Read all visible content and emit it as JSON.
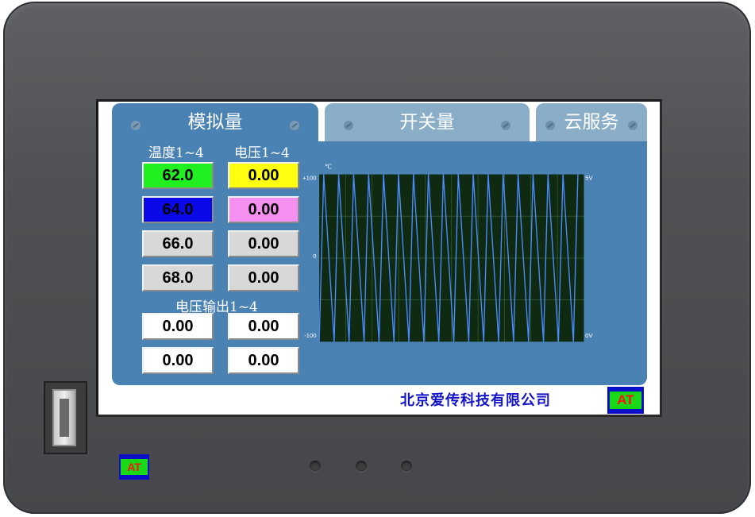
{
  "tabs": [
    {
      "label": "模拟量",
      "active": true
    },
    {
      "label": "开关量",
      "active": false
    },
    {
      "label": "云服务",
      "active": false
    }
  ],
  "analog": {
    "temp_label": "温度1~4",
    "volt_label": "电压1~4",
    "out_label": "电压输出1~4",
    "temps": [
      {
        "value": "62.0",
        "bg": "#20f020",
        "fg": "#000000"
      },
      {
        "value": "64.0",
        "bg": "#0a0ae8",
        "fg": "#000000"
      },
      {
        "value": "66.0",
        "bg": "#d8d8d8",
        "fg": "#000000"
      },
      {
        "value": "68.0",
        "bg": "#d8d8d8",
        "fg": "#000000"
      }
    ],
    "volts": [
      {
        "value": "0.00",
        "bg": "#ffff10",
        "fg": "#000000"
      },
      {
        "value": "0.00",
        "bg": "#f590f0",
        "fg": "#000000"
      },
      {
        "value": "0.00",
        "bg": "#d8d8d8",
        "fg": "#000000"
      },
      {
        "value": "0.00",
        "bg": "#d8d8d8",
        "fg": "#000000"
      }
    ],
    "outputs": [
      "0.00",
      "0.00",
      "0.00",
      "0.00"
    ]
  },
  "chart": {
    "unit_left": "℃",
    "y_left_top": "+100",
    "y_left_mid": "0",
    "y_left_bottom": "-100",
    "y_right_top": "5V",
    "y_right_bottom": "0V",
    "background": "#0f2a10",
    "grid_color": "#3c6a3c",
    "line_color": "#4a8aff"
  },
  "chart_data": {
    "type": "line",
    "title": "",
    "ylabel": "℃",
    "ylim": [
      -100,
      100
    ],
    "y2lim": [
      0,
      5
    ],
    "series": [
      {
        "values": [
          -100,
          100,
          -100,
          100,
          -100,
          100,
          -100,
          100,
          -100,
          100,
          -100,
          100,
          -100,
          100,
          -100,
          100,
          -100,
          100,
          -100,
          100,
          -100,
          100,
          -100,
          100,
          -100,
          100,
          -100,
          100,
          -100,
          100,
          -100,
          100,
          -100,
          100,
          -100,
          100
        ]
      }
    ],
    "grid": true
  },
  "footer": {
    "company": "北京爱传科技有限公司",
    "logo_text": "AT"
  },
  "device": {
    "logo_text": "AT"
  }
}
